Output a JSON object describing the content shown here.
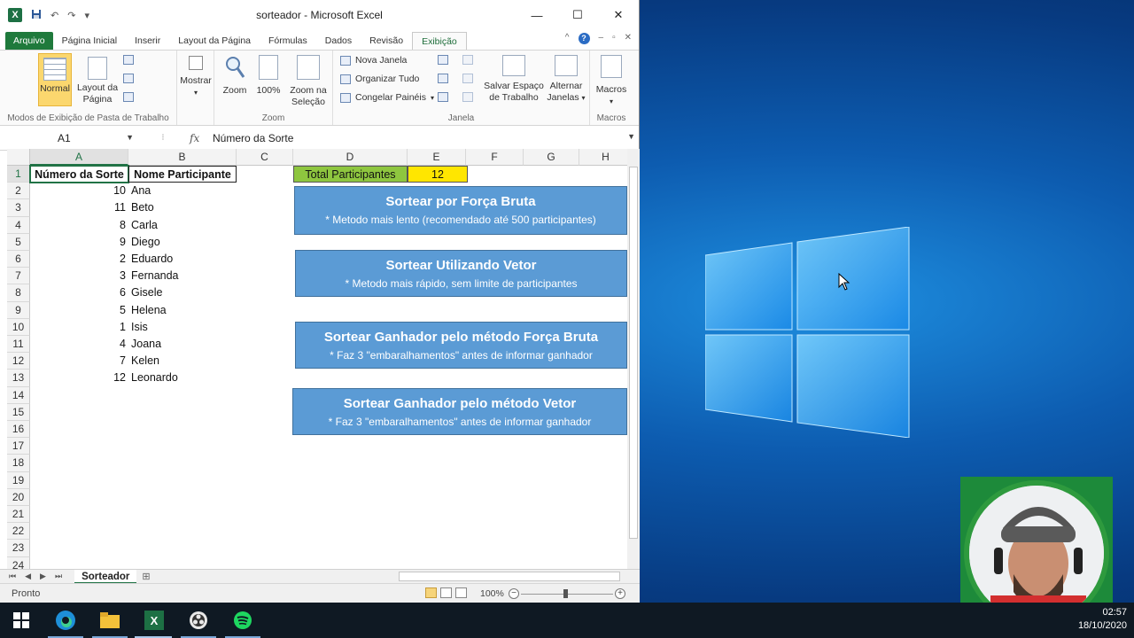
{
  "window": {
    "title": "sorteador - Microsoft Excel",
    "minimize": "—",
    "maximize": "☐",
    "close": "✕"
  },
  "quick_access": {
    "app_icon": "X",
    "undo": "↶",
    "redo": "↷",
    "customize": "▾"
  },
  "ribbon_tabs": [
    "Arquivo",
    "Página Inicial",
    "Inserir",
    "Layout da Página",
    "Fórmulas",
    "Dados",
    "Revisão",
    "Exibição"
  ],
  "active_tab": "Exibição",
  "ribbon": {
    "workbook_views": {
      "label": "Modos de Exibição de Pasta de Trabalho",
      "normal": "Normal",
      "page_layout_1": "Layout da",
      "page_layout_2": "Página"
    },
    "show": {
      "label": "Mostrar"
    },
    "zoom": {
      "label": "Zoom",
      "zoom": "Zoom",
      "zoom100": "100%",
      "zoom_sel_1": "Zoom na",
      "zoom_sel_2": "Seleção"
    },
    "window": {
      "label": "Janela",
      "new_window": "Nova Janela",
      "arrange_all": "Organizar Tudo",
      "freeze_panes": "Congelar Painéis",
      "save_ws_1": "Salvar Espaço",
      "save_ws_2": "de Trabalho",
      "switch_1": "Alternar",
      "switch_2": "Janelas"
    },
    "macros": {
      "label": "Macros",
      "macros": "Macros"
    }
  },
  "formula_bar": {
    "name_box": "A1",
    "fx": "fx",
    "content": "Número da Sorte"
  },
  "columns": [
    "A",
    "B",
    "C",
    "D",
    "E",
    "F",
    "G",
    "H"
  ],
  "rows": [
    "1",
    "2",
    "3",
    "4",
    "5",
    "6",
    "7",
    "8",
    "9",
    "10",
    "11",
    "12",
    "13",
    "14",
    "15",
    "16",
    "17",
    "18",
    "19",
    "20",
    "21",
    "22",
    "23",
    "24"
  ],
  "table": {
    "header_a": "Número da Sorte",
    "header_b": "Nome Participante",
    "entries": [
      {
        "num": "10",
        "name": "Ana"
      },
      {
        "num": "11",
        "name": "Beto"
      },
      {
        "num": "8",
        "name": "Carla"
      },
      {
        "num": "9",
        "name": "Diego"
      },
      {
        "num": "2",
        "name": "Eduardo"
      },
      {
        "num": "3",
        "name": "Fernanda"
      },
      {
        "num": "6",
        "name": "Gisele"
      },
      {
        "num": "5",
        "name": "Helena"
      },
      {
        "num": "1",
        "name": "Isis"
      },
      {
        "num": "4",
        "name": "Joana"
      },
      {
        "num": "7",
        "name": "Kelen"
      },
      {
        "num": "12",
        "name": "Leonardo"
      }
    ]
  },
  "total": {
    "label": "Total Participantes",
    "value": "12"
  },
  "buttons": [
    {
      "title": "Sortear por Força Bruta",
      "subtitle": "* Metodo mais lento (recomendado  até 500 participantes)"
    },
    {
      "title": "Sortear Utilizando Vetor",
      "subtitle": "* Metodo mais rápido, sem limite de participantes"
    },
    {
      "title": "Sortear Ganhador pelo método Força Bruta",
      "subtitle": "* Faz 3 \"embaralhamentos\"  antes de informar ganhador"
    },
    {
      "title": "Sortear Ganhador pelo método Vetor",
      "subtitle": "* Faz 3 \"embaralhamentos\"  antes de informar ganhador"
    }
  ],
  "sheet_tab": "Sorteador",
  "status": {
    "text": "Pronto",
    "zoom": "100%"
  },
  "taskbar": {
    "time": "02:57",
    "date": "18/10/2020"
  },
  "colors": {
    "excel_green": "#217346",
    "button_blue": "#5b9bd5",
    "total_green": "#8ec63f",
    "total_yellow": "#ffe600"
  }
}
